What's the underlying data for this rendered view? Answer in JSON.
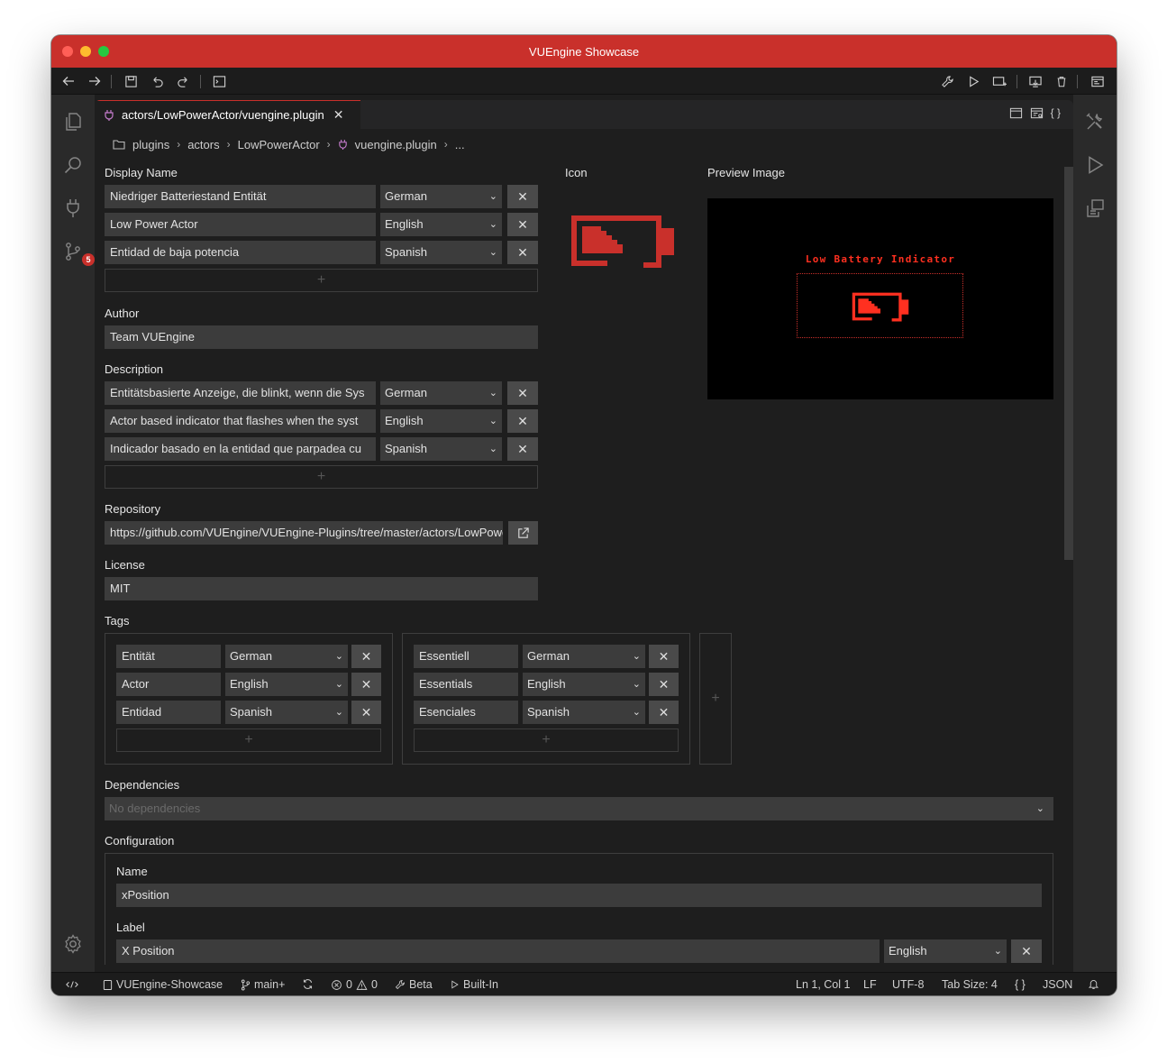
{
  "window": {
    "title": "VUEngine Showcase"
  },
  "activity_bar": {
    "scm_badge": "5"
  },
  "tab": {
    "label": "actors/LowPowerActor/vuengine.plugin"
  },
  "breadcrumb": {
    "items": [
      "plugins",
      "actors",
      "LowPowerActor",
      "vuengine.plugin",
      "..."
    ]
  },
  "display_name": {
    "label": "Display Name",
    "rows": [
      {
        "value": "Niedriger Batteriestand Entität",
        "language": "German"
      },
      {
        "value": "Low Power Actor",
        "language": "English"
      },
      {
        "value": "Entidad de baja potencia",
        "language": "Spanish"
      }
    ]
  },
  "icon": {
    "label": "Icon",
    "accent_color": "#c9302b"
  },
  "preview_image": {
    "label": "Preview Image",
    "text": "Low Battery Indicator",
    "accent_color": "#ff3020"
  },
  "author": {
    "label": "Author",
    "value": "Team VUEngine"
  },
  "description": {
    "label": "Description",
    "rows": [
      {
        "value": "Entitätsbasierte Anzeige, die blinkt, wenn die Sys",
        "language": "German"
      },
      {
        "value": "Actor based indicator that flashes when the syst",
        "language": "English"
      },
      {
        "value": "Indicador basado en la entidad que parpadea cu",
        "language": "Spanish"
      }
    ]
  },
  "repository": {
    "label": "Repository",
    "value": "https://github.com/VUEngine/VUEngine-Plugins/tree/master/actors/LowPowerActor"
  },
  "license": {
    "label": "License",
    "value": "MIT"
  },
  "tags": {
    "label": "Tags",
    "groups": [
      {
        "rows": [
          {
            "value": "Entität",
            "language": "German"
          },
          {
            "value": "Actor",
            "language": "English"
          },
          {
            "value": "Entidad",
            "language": "Spanish"
          }
        ]
      },
      {
        "rows": [
          {
            "value": "Essentiell",
            "language": "German"
          },
          {
            "value": "Essentials",
            "language": "English"
          },
          {
            "value": "Esenciales",
            "language": "Spanish"
          }
        ]
      }
    ]
  },
  "dependencies": {
    "label": "Dependencies",
    "placeholder": "No dependencies"
  },
  "configuration": {
    "label": "Configuration",
    "name_label": "Name",
    "name_value": "xPosition",
    "label_label": "Label",
    "label_value": "X Position",
    "label_language": "English"
  },
  "status_bar": {
    "workspace": "VUEngine-Showcase",
    "branch": "main+",
    "errors": "0",
    "warnings": "0",
    "build_mode": "Beta",
    "emulator": "Built-In",
    "cursor": "Ln 1, Col 1",
    "eol": "LF",
    "encoding": "UTF-8",
    "tab_size": "Tab Size: 4",
    "braces": "{ }",
    "language": "JSON"
  }
}
